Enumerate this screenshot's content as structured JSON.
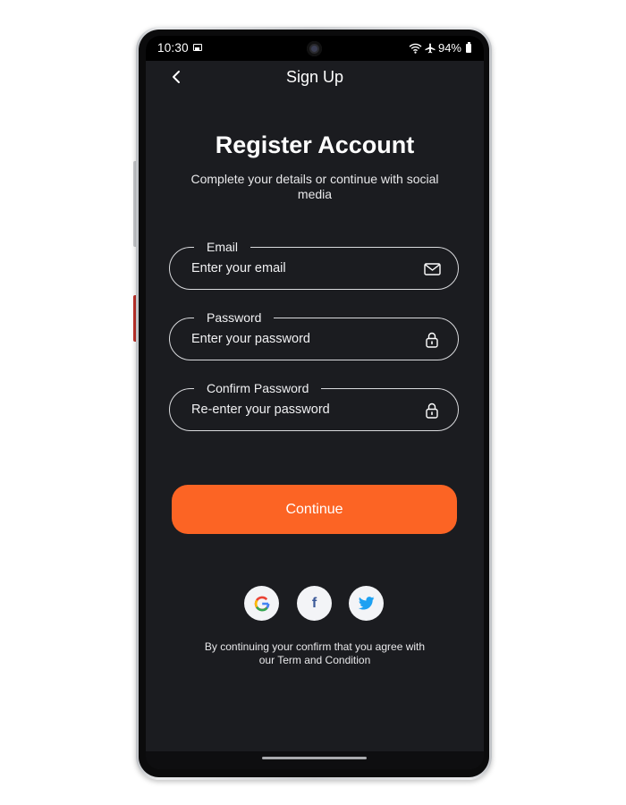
{
  "status_bar": {
    "time": "10:30",
    "battery": "94%",
    "icons": [
      "image-icon",
      "wifi-icon",
      "airplane-icon",
      "battery-icon"
    ]
  },
  "header": {
    "title": "Sign Up",
    "back_icon": "chevron-left-icon"
  },
  "main": {
    "title": "Register Account",
    "subtitle": "Complete your details or continue with social media"
  },
  "form": {
    "email": {
      "label": "Email",
      "placeholder": "Enter your email",
      "value": "",
      "icon": "mail-icon"
    },
    "password": {
      "label": "Password",
      "placeholder": "Enter your password",
      "value": "",
      "icon": "lock-icon"
    },
    "confirm_password": {
      "label": "Confirm Password",
      "placeholder": "Re-enter your password",
      "value": "",
      "icon": "lock-icon"
    },
    "continue_label": "Continue"
  },
  "social": {
    "items": [
      "google-icon",
      "facebook-icon",
      "twitter-icon"
    ],
    "facebook_glyph": "f"
  },
  "terms": {
    "line1": "By continuing your confirm that you agree with",
    "line2": "our Term and Condition"
  },
  "colors": {
    "background": "#1b1c20",
    "accent": "#fc6424",
    "text": "#ffffff",
    "social_bg": "#f3f4f7"
  }
}
